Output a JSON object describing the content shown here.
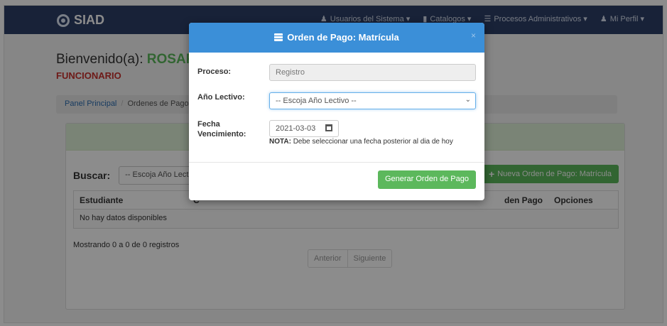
{
  "navbar": {
    "brand": "SIAD",
    "menu": [
      {
        "label": "Usuarios del Sistema ▾",
        "icon": "users-icon"
      },
      {
        "label": "Catalogos ▾",
        "icon": "file-icon"
      },
      {
        "label": "Procesos Administrativos ▾",
        "icon": "list-icon"
      },
      {
        "label": "Mi Perfil ▾",
        "icon": "user-icon"
      }
    ]
  },
  "welcome": {
    "prefix": "Bienvenido(a): ",
    "name": "ROSARIO",
    "role": "FUNCIONARIO"
  },
  "breadcrumb": {
    "items": [
      "Panel Principal",
      "Ordenes de Pago: Matrícula"
    ]
  },
  "panel": {
    "search_label": "Buscar:",
    "search_select": "-- Escoja Año Lectivo --",
    "add_button": "Nueva Orden de Pago: Matrícula",
    "columns": [
      "Estudiante",
      "C",
      "den Pago",
      "Opciones"
    ],
    "empty_text": "No hay datos disponibles",
    "info": "Mostrando 0 a 0 de 0 registros",
    "pager": [
      "Anterior",
      "Siguiente"
    ]
  },
  "modal": {
    "title": "Orden de Pago: Matrícula",
    "close": "×",
    "proceso_label": "Proceso:",
    "proceso_value": "Registro",
    "anio_label": "Año Lectivo:",
    "anio_value": "-- Escoja Año Lectivo --",
    "fecha_label_1": "Fecha",
    "fecha_label_2": "Vencimiento:",
    "fecha_value": "2021-03-03",
    "note_bold": "NOTA:",
    "note_text": " Debe seleccionar una fecha posterior al dia de hoy",
    "submit": "Generar Orden de Pago"
  },
  "colors": {
    "navbar": "#2c3e66",
    "modal_header": "#3b8fd8",
    "success": "#5cb85c",
    "danger": "#c9302c"
  }
}
